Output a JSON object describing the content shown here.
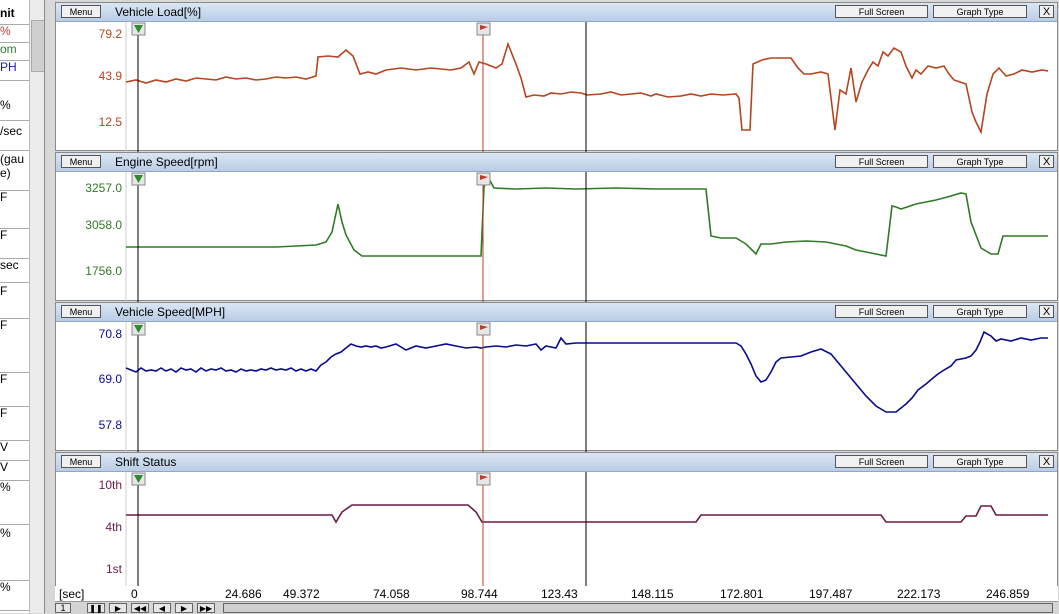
{
  "sidebar": {
    "rows": [
      {
        "text": "nit",
        "color": "#000"
      },
      {
        "text": "%",
        "color": "#c0392b"
      },
      {
        "text": "om",
        "color": "#2e7d32"
      },
      {
        "text": "PH",
        "color": "#1a1aaa"
      },
      {
        "text": "%",
        "color": "#000"
      },
      {
        "text": "/sec",
        "color": "#000"
      },
      {
        "text": "(gau\ne)",
        "color": "#000"
      },
      {
        "text": "F",
        "color": "#000"
      },
      {
        "text": "F",
        "color": "#000"
      },
      {
        "text": "sec",
        "color": "#000"
      },
      {
        "text": "F",
        "color": "#000"
      },
      {
        "text": "F",
        "color": "#000"
      },
      {
        "text": "F",
        "color": "#000"
      },
      {
        "text": "F",
        "color": "#000"
      },
      {
        "text": "V",
        "color": "#000"
      },
      {
        "text": "V",
        "color": "#000"
      },
      {
        "text": "%",
        "color": "#000"
      },
      {
        "text": "%",
        "color": "#000"
      },
      {
        "text": "%",
        "color": "#000"
      }
    ]
  },
  "buttons": {
    "menu": "Menu",
    "fullscreen": "Full Screen",
    "graphtype": "Graph Type",
    "close": "X"
  },
  "panels": [
    {
      "title": "Vehicle Load[%]",
      "color": "#b5441f",
      "ticks": [
        "79.2",
        "43.9",
        "12.5"
      ]
    },
    {
      "title": "Engine Speed[rpm]",
      "color": "#2f7a26",
      "ticks": [
        "3257.0",
        "3058.0",
        "1756.0"
      ]
    },
    {
      "title": "Vehicle Speed[MPH]",
      "color": "#0a0a8c",
      "ticks": [
        "70.8",
        "69.0",
        "57.8"
      ]
    },
    {
      "title": "Shift Status",
      "color": "#6b1a4a",
      "ticks": [
        "10th",
        "4th",
        "1st"
      ]
    }
  ],
  "time_axis": {
    "unit": "[sec]",
    "labels": [
      "0",
      "24.686",
      "49.372",
      "74.058",
      "98.744",
      "123.43",
      "148.115",
      "172.801",
      "197.487",
      "222.173",
      "246.859"
    ]
  },
  "controls": {
    "page": "1"
  }
}
